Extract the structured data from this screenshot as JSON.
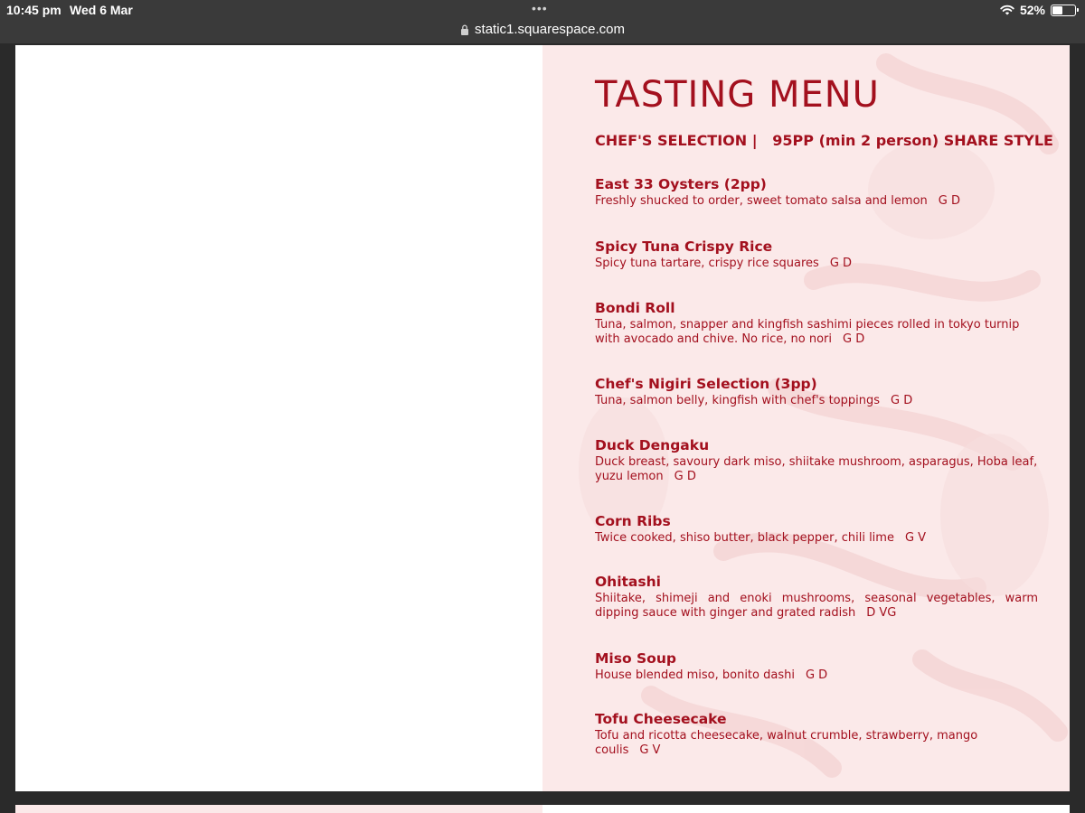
{
  "status_bar": {
    "time": "10:45 pm",
    "date": "Wed 6 Mar",
    "dots": "•••",
    "battery_percent_label": "52%",
    "battery_level": 0.52
  },
  "browser": {
    "url": "static1.squarespace.com"
  },
  "menu": {
    "title": "TASTING MENU",
    "subtitle": "CHEF'S SELECTION |   95PP (min 2 person) SHARE STYLE",
    "items": [
      {
        "name": "East 33 Oysters (2pp)",
        "description": "Freshly shucked to order, sweet tomato salsa and lemon",
        "tags": "G D"
      },
      {
        "name": "Spicy Tuna Crispy Rice",
        "description": "Spicy tuna tartare, crispy rice squares",
        "tags": "G D"
      },
      {
        "name": "Bondi Roll",
        "description": "Tuna, salmon, snapper and kingfish sashimi pieces rolled in tokyo turnip with avocado and chive. No rice, no nori",
        "tags": "G D"
      },
      {
        "name": "Chef's Nigiri Selection (3pp)",
        "description": "Tuna, salmon belly, kingfish with chef's toppings",
        "tags": "G D"
      },
      {
        "name": "Duck Dengaku",
        "description": "Duck breast, savoury dark miso, shiitake mushroom, asparagus, Hoba leaf, yuzu lemon",
        "tags": "G D"
      },
      {
        "name": "Corn Ribs",
        "description": "Twice cooked, shiso butter, black pepper, chili lime",
        "tags": "G V"
      },
      {
        "name": "Ohitashi",
        "description": "Shiitake, shimeji and enoki mushrooms, seasonal vegetables, warm dipping sauce with ginger and grated radish",
        "tags": "D VG"
      },
      {
        "name": "Miso Soup",
        "description": "House blended miso, bonito dashi",
        "tags": "G D"
      },
      {
        "name": "Tofu Cheesecake",
        "description": "Tofu and ricotta cheesecake, walnut crumble, strawberry, mango coulis",
        "tags": "G V"
      }
    ]
  },
  "colors": {
    "accent": "#a3101e",
    "panel_bg": "#fbe9e9",
    "chrome_bg": "#3a3a3a"
  }
}
